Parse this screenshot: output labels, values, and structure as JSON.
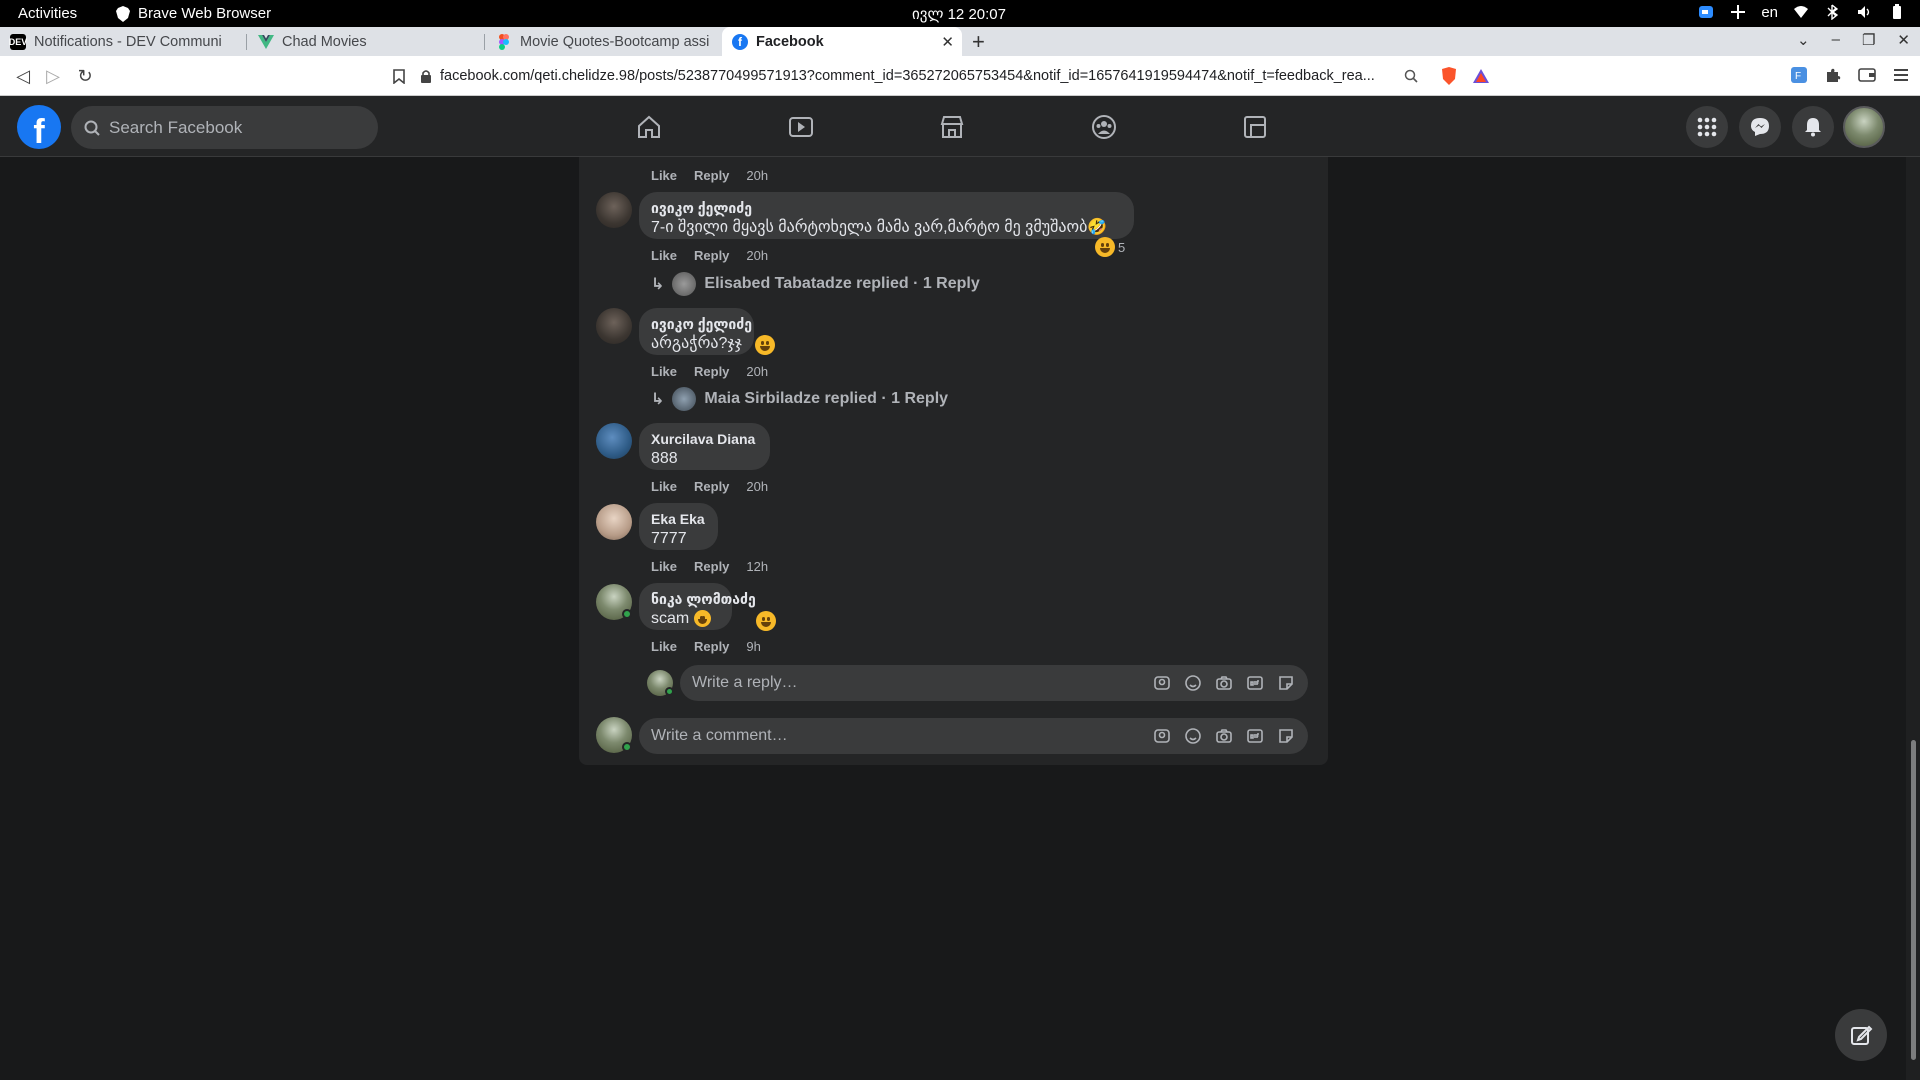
{
  "os": {
    "activities": "Activities",
    "app_name": "Brave Web Browser",
    "clock": "ივლ 12  20:07",
    "lang": "en"
  },
  "tabs": [
    {
      "label": "Notifications - DEV Communi",
      "icon": "dev-icon"
    },
    {
      "label": "Chad Movies",
      "icon": "vue-icon"
    },
    {
      "label": "Movie Quotes-Bootcamp assi",
      "icon": "figma-icon"
    },
    {
      "label": "Facebook",
      "icon": "facebook-icon",
      "active": true
    }
  ],
  "address": {
    "url": "facebook.com/qeti.chelidze.98/posts/5238770499571913?comment_id=365272065753454&notif_id=1657641919594474&notif_t=feedback_rea..."
  },
  "fb": {
    "search_placeholder": "Search Facebook"
  },
  "comments": [
    {
      "actions": {
        "like": "Like",
        "reply": "Reply",
        "time": "20h"
      }
    },
    {
      "name": "ივიკო ქელიძე",
      "text": "7-ი შვილი მყავს მარტოხელა მამა ვარ,მარტო მე ვმუშაობ🤣",
      "reaction_count": "5",
      "actions": {
        "like": "Like",
        "reply": "Reply",
        "time": "20h"
      },
      "replied": "Elisabed Tabatadze replied · 1 Reply"
    },
    {
      "name": "ივიკო ქელიძე",
      "text": "არგაჭრა?ჯჯ",
      "actions": {
        "like": "Like",
        "reply": "Reply",
        "time": "20h"
      },
      "replied": "Maia Sirbiladze replied · 1 Reply"
    },
    {
      "name": "Xurcilava Diana",
      "text": "888",
      "actions": {
        "like": "Like",
        "reply": "Reply",
        "time": "20h"
      }
    },
    {
      "name": "Eka Eka",
      "text": "7777",
      "actions": {
        "like": "Like",
        "reply": "Reply",
        "time": "12h"
      }
    },
    {
      "name": "ნიკა ლომთაძე",
      "text": "scam",
      "actions": {
        "like": "Like",
        "reply": "Reply",
        "time": "9h"
      }
    }
  ],
  "composer": {
    "reply_placeholder": "Write a reply…",
    "comment_placeholder": "Write a comment…"
  },
  "colors": {
    "fb_blue": "#1877f2",
    "surface": "#242526",
    "bubble": "#3a3b3c",
    "background": "#18191a",
    "online": "#31a24c"
  }
}
